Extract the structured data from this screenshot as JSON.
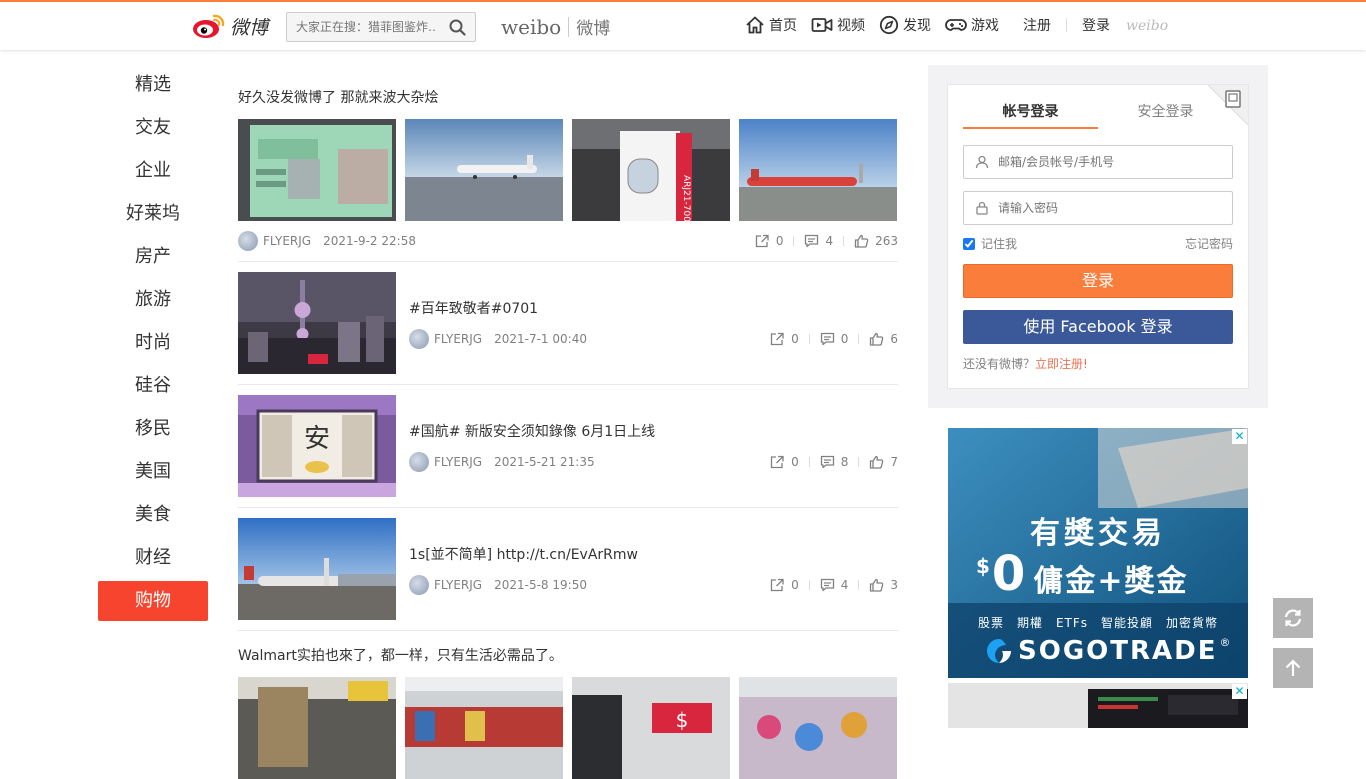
{
  "header": {
    "logo_text": "微博",
    "search_placeholder": "大家正在搜：猎菲图鉴炸…",
    "brand_en": "weibo",
    "brand_cn": "微博",
    "nav": [
      {
        "label": "首页",
        "icon": "home-icon"
      },
      {
        "label": "视频",
        "icon": "video-icon"
      },
      {
        "label": "发现",
        "icon": "compass-icon"
      },
      {
        "label": "游戏",
        "icon": "gamepad-icon"
      }
    ],
    "register": "注册",
    "login": "登录",
    "small_logo": "weibo"
  },
  "sidebar": {
    "items": [
      "精选",
      "交友",
      "企业",
      "好莱坞",
      "房产",
      "旅游",
      "时尚",
      "硅谷",
      "移民",
      "美国",
      "美食",
      "财经",
      "购物"
    ],
    "active": "购物"
  },
  "feed": {
    "posts": [
      {
        "text": "好久没发微博了 那就来波大杂烩",
        "user": "FLYERJG",
        "time": "2021-9-2 22:58",
        "reposts": "0",
        "comments": "4",
        "likes": "263"
      },
      {
        "text": "#百年致敬者#0701",
        "user": "FLYERJG",
        "time": "2021-7-1 00:40",
        "reposts": "0",
        "comments": "0",
        "likes": "6"
      },
      {
        "text": "#国航# 新版安全须知錄像 6月1日上线",
        "user": "FLYERJG",
        "time": "2021-5-21 21:35",
        "reposts": "0",
        "comments": "8",
        "likes": "7"
      },
      {
        "text": "1s[並不简单] http://t.cn/EvArRmw",
        "user": "FLYERJG",
        "time": "2021-5-8 19:50",
        "reposts": "0",
        "comments": "4",
        "likes": "3"
      },
      {
        "text": "Walmart实拍也來了，都一样，只有生活必需品了。"
      }
    ]
  },
  "login": {
    "tab_account": "帐号登录",
    "tab_secure": "安全登录",
    "username_placeholder": "邮箱/会员帐号/手机号",
    "password_placeholder": "请输入密码",
    "remember": "记住我",
    "forgot": "忘记密码",
    "submit": "登录",
    "facebook": "使用 Facebook 登录",
    "no_account": "还没有微博？",
    "register_now": "立即注册!"
  },
  "ad": {
    "line1": "有獎交易",
    "dollar": "$",
    "zero": "0",
    "line2": "傭金+獎金",
    "items": "股票　期權　ETFs　智能投顧　加密貨幣",
    "brand": "SOGOTRADE",
    "reg_mark": "®",
    "close": "✕"
  },
  "colors": {
    "accent": "#fa7d3c",
    "active_nav": "#f7442e",
    "facebook": "#3b5998",
    "link": "#eb7350"
  }
}
